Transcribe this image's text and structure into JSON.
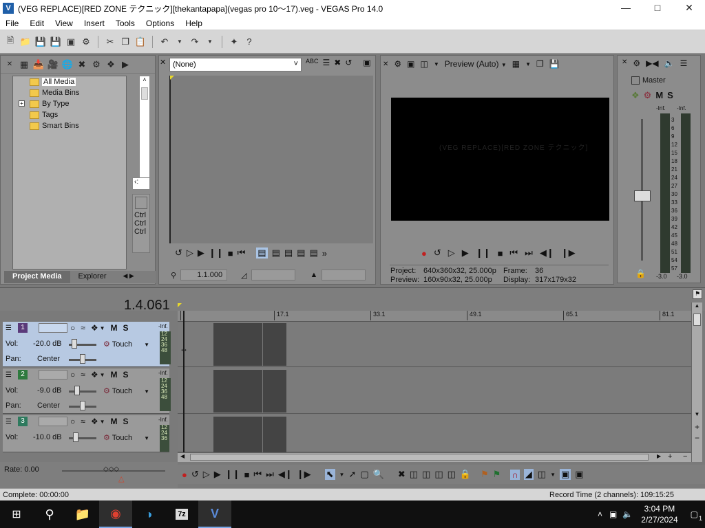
{
  "window": {
    "title": "(VEG REPLACE)[RED ZONE テクニック][thekantapapa](vegas pro 10～17).veg - VEGAS Pro 14.0",
    "app_icon": "V"
  },
  "menu": [
    "File",
    "Edit",
    "View",
    "Insert",
    "Tools",
    "Options",
    "Help"
  ],
  "project_media": {
    "tree": [
      {
        "label": "All Media",
        "selected": true
      },
      {
        "label": "Media Bins"
      },
      {
        "label": "By Type",
        "expandable": true
      },
      {
        "label": "Tags"
      },
      {
        "label": "Smart Bins"
      }
    ],
    "side_labels": [
      "Ctrl",
      "Ctrl",
      "Ctrl"
    ],
    "side_icon_label": "",
    "tabs": [
      "Project Media",
      "Explorer"
    ]
  },
  "trimmer": {
    "selector_value": "(None)",
    "timecode": "1.1.000"
  },
  "preview": {
    "mode": "Preview (Auto)",
    "watermark": "(VEG REPLACE)[RED ZONE テクニック]",
    "project_label": "Project:",
    "project_value": "640x360x32, 25.000p",
    "preview_label": "Preview:",
    "preview_value": "160x90x32, 25.000p",
    "frame_label": "Frame:",
    "frame_value": "36",
    "display_label": "Display:",
    "display_value": "317x179x32"
  },
  "master": {
    "label": "Master",
    "m": "M",
    "s": "S",
    "peak_left": "-Inf.",
    "peak_right": "-Inf.",
    "scale": [
      "3",
      "6",
      "9",
      "12",
      "15",
      "18",
      "21",
      "24",
      "27",
      "30",
      "33",
      "36",
      "39",
      "42",
      "45",
      "48",
      "51",
      "54",
      "57"
    ],
    "level_left": "-3.0",
    "level_right": "-3.0"
  },
  "timeline": {
    "cursor_time": "1.4.061",
    "ruler": [
      "17.1",
      "33.1",
      "49.1",
      "65.1",
      "81.1"
    ],
    "tracks": [
      {
        "number": "1",
        "vol_label": "Vol:",
        "vol": "-20.0 dB",
        "pan_label": "Pan:",
        "pan": "Center",
        "mode": "Touch",
        "m": "M",
        "s": "S",
        "peak": "-Inf.",
        "meter": [
          "12",
          "24",
          "36",
          "48"
        ],
        "selected": true,
        "color": "#5a3a7a"
      },
      {
        "number": "2",
        "vol_label": "Vol:",
        "vol": "-9.0 dB",
        "pan_label": "Pan:",
        "pan": "Center",
        "mode": "Touch",
        "m": "M",
        "s": "S",
        "peak": "-Inf.",
        "meter": [
          "12",
          "24",
          "36",
          "48"
        ],
        "selected": false,
        "color": "#2e7a3e"
      },
      {
        "number": "3",
        "vol_label": "Vol:",
        "vol": "-10.0 dB",
        "pan_label": "",
        "pan": "",
        "mode": "Touch",
        "m": "M",
        "s": "S",
        "peak": "-Inf.",
        "meter": [
          "12",
          "24",
          "36"
        ],
        "selected": false,
        "color": "#2e7a5e"
      }
    ],
    "rate_label": "Rate: 0.00"
  },
  "status": {
    "complete": "Complete: 00:00:00",
    "record_time": "Record Time (2 channels): 109:15:25"
  },
  "taskbar": {
    "time": "3:04 PM",
    "date": "2/27/2024",
    "notification_count": "1"
  }
}
